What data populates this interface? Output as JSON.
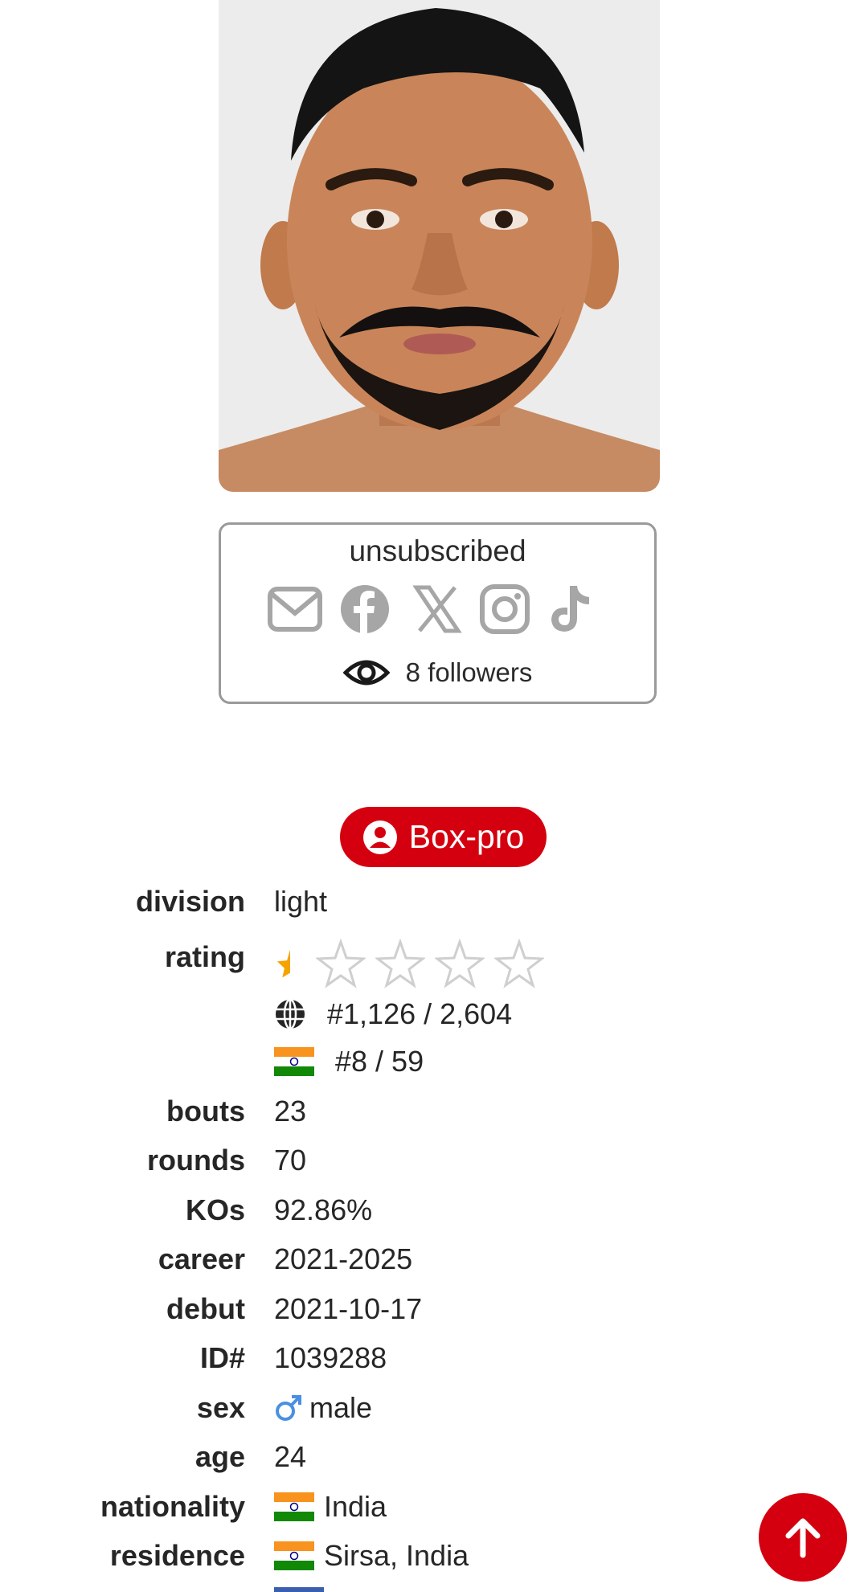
{
  "profile": {
    "photo_alt": "fighter portrait",
    "subscription_status": "unsubscribed",
    "social_icons": [
      "email-icon",
      "facebook-icon",
      "x-icon",
      "instagram-icon",
      "tiktok-icon"
    ],
    "followers_text": "8 followers"
  },
  "badge": {
    "label": "Box-pro",
    "color": "#d5000f"
  },
  "stats": {
    "division": {
      "label": "division",
      "value": "light"
    },
    "rating": {
      "label": "rating",
      "stars_filled": 0.5,
      "stars_total": 5
    },
    "world_rank": "#1,126 / 2,604",
    "country_rank": "#8 / 59",
    "bouts": {
      "label": "bouts",
      "value": "23"
    },
    "rounds": {
      "label": "rounds",
      "value": "70"
    },
    "kos": {
      "label": "KOs",
      "value": "92.86%"
    },
    "career": {
      "label": "career",
      "value": "2021-2025"
    },
    "debut": {
      "label": "debut",
      "value": "2021-10-17"
    },
    "id": {
      "label": "ID#",
      "value": "1039288"
    },
    "sex": {
      "label": "sex",
      "value": "male"
    },
    "age": {
      "label": "age",
      "value": "24"
    },
    "nationality": {
      "label": "nationality",
      "value": "India"
    },
    "residence": {
      "label": "residence",
      "value": "Sirsa, India"
    }
  },
  "colors": {
    "accent": "#d5000f",
    "star_gold": "#f5a300",
    "male_icon": "#4a90e2"
  }
}
